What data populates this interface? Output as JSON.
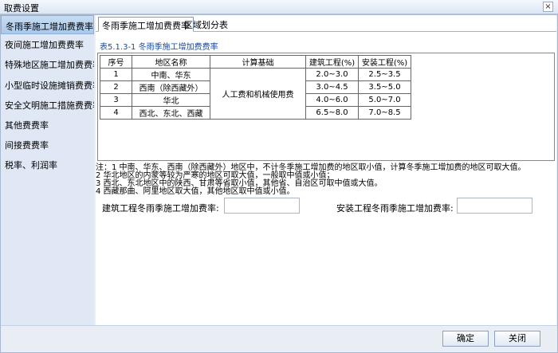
{
  "window": {
    "title": "取费设置",
    "close_glyph": "×"
  },
  "sidebar": {
    "items": [
      {
        "label": "冬雨季施工增加费费率"
      },
      {
        "label": "夜间施工增加费费率"
      },
      {
        "label": "特殊地区施工增加费费率"
      },
      {
        "label": "小型临时设施摊销费费率"
      },
      {
        "label": "安全文明施工措施费费率"
      },
      {
        "label": "其他费费率"
      },
      {
        "label": "间接费费率"
      },
      {
        "label": "税率、利润率"
      }
    ],
    "active_index": 0
  },
  "tabs": [
    {
      "label": "冬雨季施工增加费费率"
    },
    {
      "label": "区域划分表"
    }
  ],
  "table": {
    "title": "表5.1.3-1  冬雨季施工增加费费率",
    "headers": [
      "序号",
      "地区名称",
      "计算基础",
      "建筑工程(%)",
      "安装工程(%)"
    ],
    "basis": "人工费和机械使用费",
    "rows": [
      {
        "no": "1",
        "region": "中南、华东",
        "building": "2.0~3.0",
        "install": "2.5~3.5"
      },
      {
        "no": "2",
        "region": "西南（除西藏外）",
        "building": "3.0~4.5",
        "install": "3.5~5.0"
      },
      {
        "no": "3",
        "region": "华北",
        "building": "4.0~6.0",
        "install": "5.0~7.0"
      },
      {
        "no": "4",
        "region": "西北、东北、西藏",
        "building": "6.5~8.0",
        "install": "7.0~8.5"
      }
    ]
  },
  "notes": [
    "注：1 中南、华东、西南（除西藏外）地区中，不计冬季施工增加费的地区取小值，计算冬季施工增加费的地区可取大值。",
    "    2 华北地区的内蒙等较为严寒的地区可取大值，一般取中值或小值；",
    "    3 西北、东北地区中的陕西、甘肃等省取小值，其他省、自治区可取中值或大值。",
    "    4 西藏那曲、阿里地区取大值，其他地区取中值或小值。"
  ],
  "form": {
    "building_label": "建筑工程冬雨季施工增加费率:",
    "building_value": "",
    "install_label": "安装工程冬雨季施工增加费率:",
    "install_value": ""
  },
  "buttons": {
    "ok": "确定",
    "close": "关闭"
  }
}
